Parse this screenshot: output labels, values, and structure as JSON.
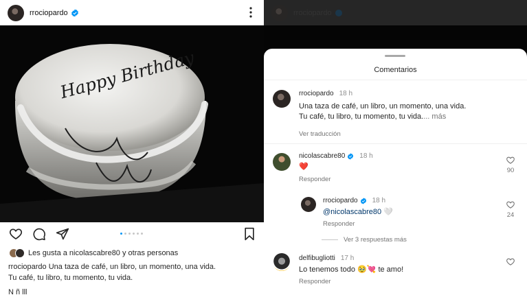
{
  "post": {
    "username": "rrociopardo",
    "likes_text": "Les gusta a nicolascabre80 y otras personas",
    "caption_user": "rrociopardo",
    "caption_line1": "Una taza de café, un libro, un momento, una vida.",
    "caption_line2": "Tu café, tu libro, tu momento, tu vida.",
    "caption_cut": "N                                                              ñ                    lll",
    "photo_text": "Happy Birthday",
    "carousel_count": 6,
    "carousel_active": 1
  },
  "comments_panel": {
    "title": "Comentarios",
    "header_username": "rrociopardo",
    "caption": {
      "username": "rrociopardo",
      "time": "18 h",
      "line1": "Una taza de café, un libro, un momento, una vida.",
      "line2": "Tu café, tu libro, tu momento, tu vida.",
      "more": "... más",
      "translate": "Ver traducción"
    },
    "comments": [
      {
        "username": "nicolascabre80",
        "verified": true,
        "time": "18 h",
        "text": "❤️",
        "reply_label": "Responder",
        "likes": "90"
      },
      {
        "username": "rrociopardo",
        "verified": true,
        "time": "18 h",
        "mention": "@nicolascabre80",
        "text": "🤍",
        "reply_label": "Responder",
        "likes": "24"
      },
      {
        "username": "delfibugliotti",
        "verified": false,
        "time": "17 h",
        "text": "Lo tenemos todo 🥹💘 te amo!",
        "reply_label": "Responder",
        "likes": ""
      }
    ],
    "more_replies": "Ver 3 respuestas más"
  },
  "colors": {
    "verified": "#0095f6",
    "link": "#00376b",
    "muted": "#737373"
  },
  "icons": [
    "verified-badge-icon",
    "more-options-icon",
    "heart-icon",
    "comment-icon",
    "share-icon",
    "bookmark-icon"
  ]
}
